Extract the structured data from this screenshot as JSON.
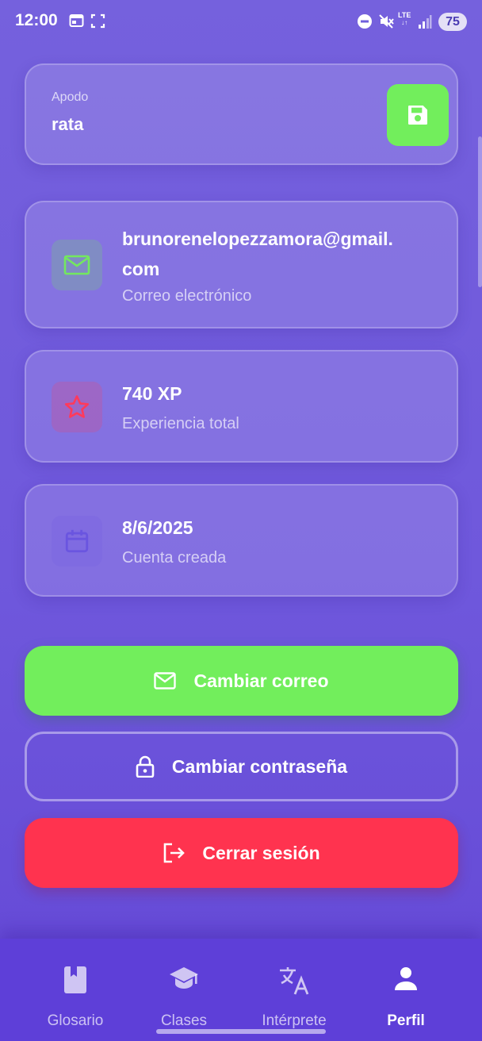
{
  "status_bar": {
    "time": "12:00",
    "network": "LTE",
    "battery": "75"
  },
  "nickname": {
    "label": "Apodo",
    "value": "rata",
    "save_icon": "floppy-disk-icon"
  },
  "info_cards": [
    {
      "icon": "mail-icon",
      "title": "brunorenelopezzamora@gmail.com",
      "title_line1": "brunorenelopezzamora@gmail.",
      "title_line2": "com",
      "subtitle": "Correo electrónico",
      "icon_color": "#73e85e"
    },
    {
      "icon": "star-icon",
      "title": "740 XP",
      "subtitle": "Experiencia total",
      "icon_color": "#ff3a5c"
    },
    {
      "icon": "calendar-icon",
      "title": "8/6/2025",
      "subtitle": "Cuenta creada",
      "icon_color": "#6a55e0"
    }
  ],
  "buttons": {
    "change_email": "Cambiar correo",
    "change_password": "Cambiar contraseña",
    "logout": "Cerrar sesión"
  },
  "bottom_nav": {
    "items": [
      {
        "label": "Glosario",
        "icon": "book-icon",
        "active": false
      },
      {
        "label": "Clases",
        "icon": "graduation-cap-icon",
        "active": false
      },
      {
        "label": "Intérprete",
        "icon": "translate-icon",
        "active": false
      },
      {
        "label": "Perfil",
        "icon": "person-icon",
        "active": true
      }
    ]
  },
  "colors": {
    "background": "#7160dc",
    "accent_green": "#72ee5c",
    "danger_red": "#ff334f",
    "nav_background": "#5e3fd8"
  }
}
